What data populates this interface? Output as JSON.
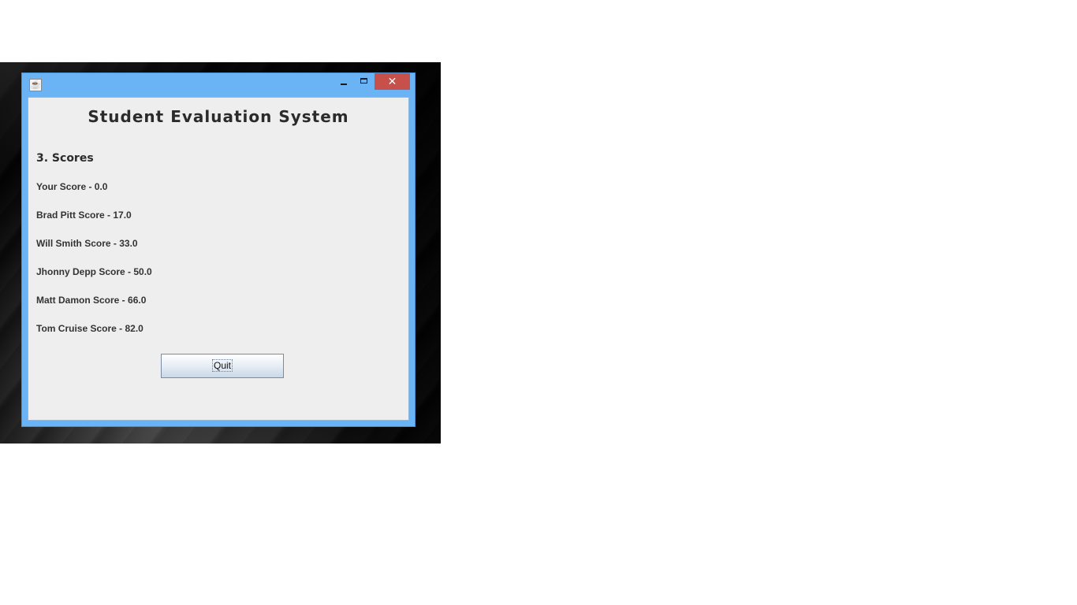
{
  "window": {
    "icon": "java-cup-icon",
    "controls": {
      "minimize_icon": "minimize-icon",
      "maximize_icon": "maximize-icon",
      "close_label": "✕"
    }
  },
  "page": {
    "title": "Student Evaluation System",
    "section_heading": "3. Scores"
  },
  "scores": [
    "Your Score - 0.0",
    "Brad Pitt Score - 17.0",
    "Will Smith Score - 33.0",
    "Jhonny Depp Score - 50.0",
    "Matt Damon Score - 66.0",
    "Tom Cruise Score - 82.0"
  ],
  "actions": {
    "quit_label": "Quit"
  },
  "colors": {
    "titlebar": "#6ab3f5",
    "close_button": "#c7504a",
    "panel": "#eeeeee"
  }
}
